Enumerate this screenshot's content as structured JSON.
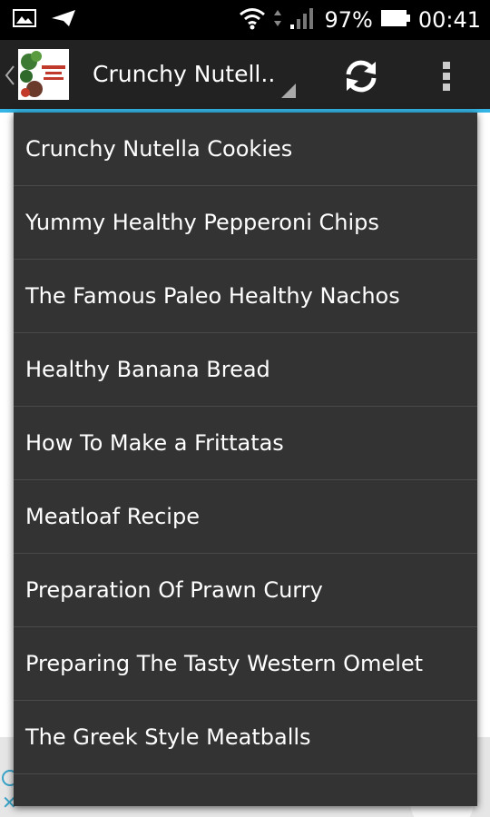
{
  "status_bar": {
    "battery": "97%",
    "time": "00:41",
    "icons": [
      "image-icon",
      "send-icon",
      "wifi-icon",
      "data-arrows-icon",
      "signal-icon",
      "battery-icon"
    ]
  },
  "action_bar": {
    "title": "Crunchy Nutell..",
    "accent": "#34b5e5",
    "icons": [
      "up-chevron-icon",
      "app-icon",
      "dropdown-triangle-icon",
      "refresh-icon",
      "overflow-menu-icon"
    ]
  },
  "dropdown": {
    "items": [
      "Crunchy Nutella Cookies",
      "Yummy Healthy Pepperoni Chips",
      "The Famous Paleo Healthy Nachos",
      "Healthy Banana Bread",
      "How To Make a Frittatas",
      "Meatloaf Recipe",
      "Preparation Of Prawn Curry",
      "Preparing The Tasty Western Omelet",
      "The Greek Style Meatballs"
    ]
  }
}
